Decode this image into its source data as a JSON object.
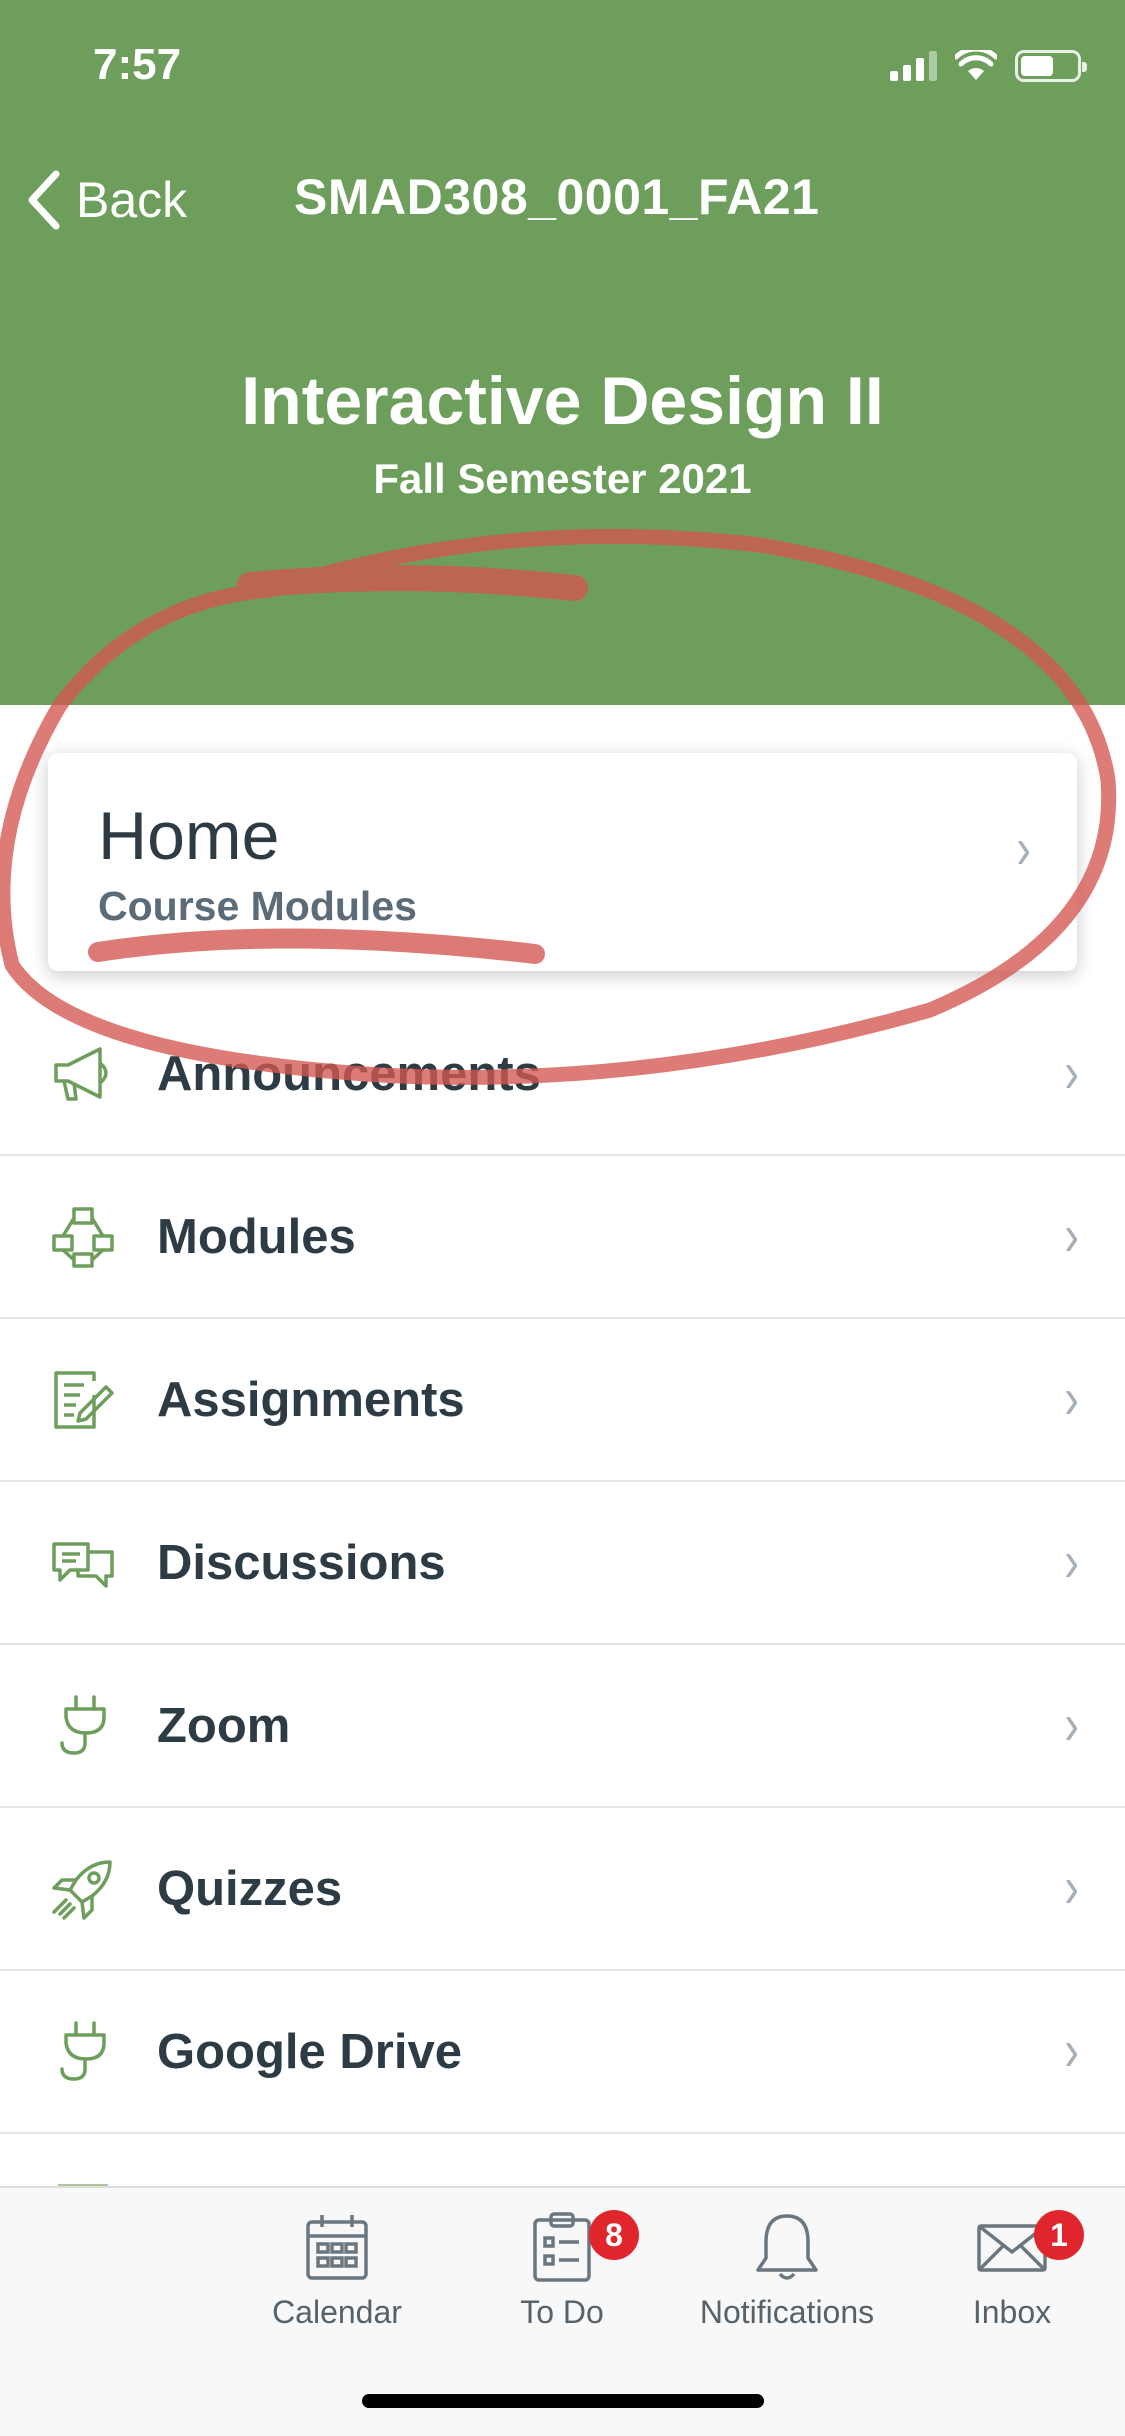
{
  "colors": {
    "brand": "#6e9e5c",
    "badge": "#e0262c",
    "annotation": "#d3574f"
  },
  "status_bar": {
    "time": "7:57"
  },
  "nav": {
    "back_label": "Back",
    "title": "SMAD308_0001_FA21"
  },
  "course": {
    "title": "Interactive Design II",
    "term": "Fall Semester 2021"
  },
  "home_card": {
    "title": "Home",
    "subtitle": "Course Modules"
  },
  "menu": {
    "items": [
      {
        "label": "Announcements",
        "icon": "megaphone-icon"
      },
      {
        "label": "Modules",
        "icon": "modules-icon"
      },
      {
        "label": "Assignments",
        "icon": "assignment-icon"
      },
      {
        "label": "Discussions",
        "icon": "discussions-icon"
      },
      {
        "label": "Zoom",
        "icon": "plug-icon"
      },
      {
        "label": "Quizzes",
        "icon": "rocket-icon"
      },
      {
        "label": "Google Drive",
        "icon": "plug-icon"
      }
    ]
  },
  "tab_bar": {
    "calendar": {
      "label": "Calendar",
      "icon": "calendar-icon"
    },
    "todo": {
      "label": "To Do",
      "icon": "todo-icon",
      "badge": "8"
    },
    "notifications": {
      "label": "Notifications",
      "icon": "bell-icon"
    },
    "inbox": {
      "label": "Inbox",
      "icon": "envelope-icon",
      "badge": "1"
    }
  }
}
